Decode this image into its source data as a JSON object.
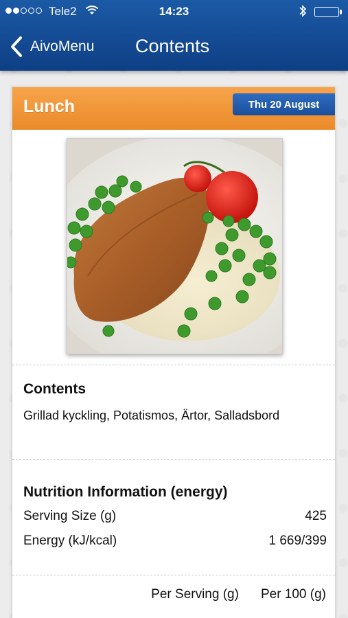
{
  "status": {
    "carrier": "Tele2",
    "time": "14:23",
    "signal_bars_filled": 2,
    "signal_bars_total": 5,
    "battery_level": 1.0
  },
  "nav": {
    "back_label": "AivoMenu",
    "title": "Contents"
  },
  "meal": {
    "title": "Lunch",
    "date": "Thu 20 August",
    "photo": "grilled-chicken-dish-photo"
  },
  "contents": {
    "heading": "Contents",
    "text": "Grillad kyckling, Potatismos, Ärtor, Salladsbord"
  },
  "nutrition": {
    "heading": "Nutrition Information (energy)",
    "rows": [
      {
        "label": "Serving Size (g)",
        "value": "425"
      },
      {
        "label": "Energy (kJ/kcal)",
        "value": "1 669/399"
      }
    ],
    "columns": [
      "Per Serving (g)",
      "Per 100 (g)"
    ]
  },
  "colors": {
    "nav_blue": "#1c5aa6",
    "header_orange": "#f39b3e",
    "badge_blue": "#2562b3"
  }
}
